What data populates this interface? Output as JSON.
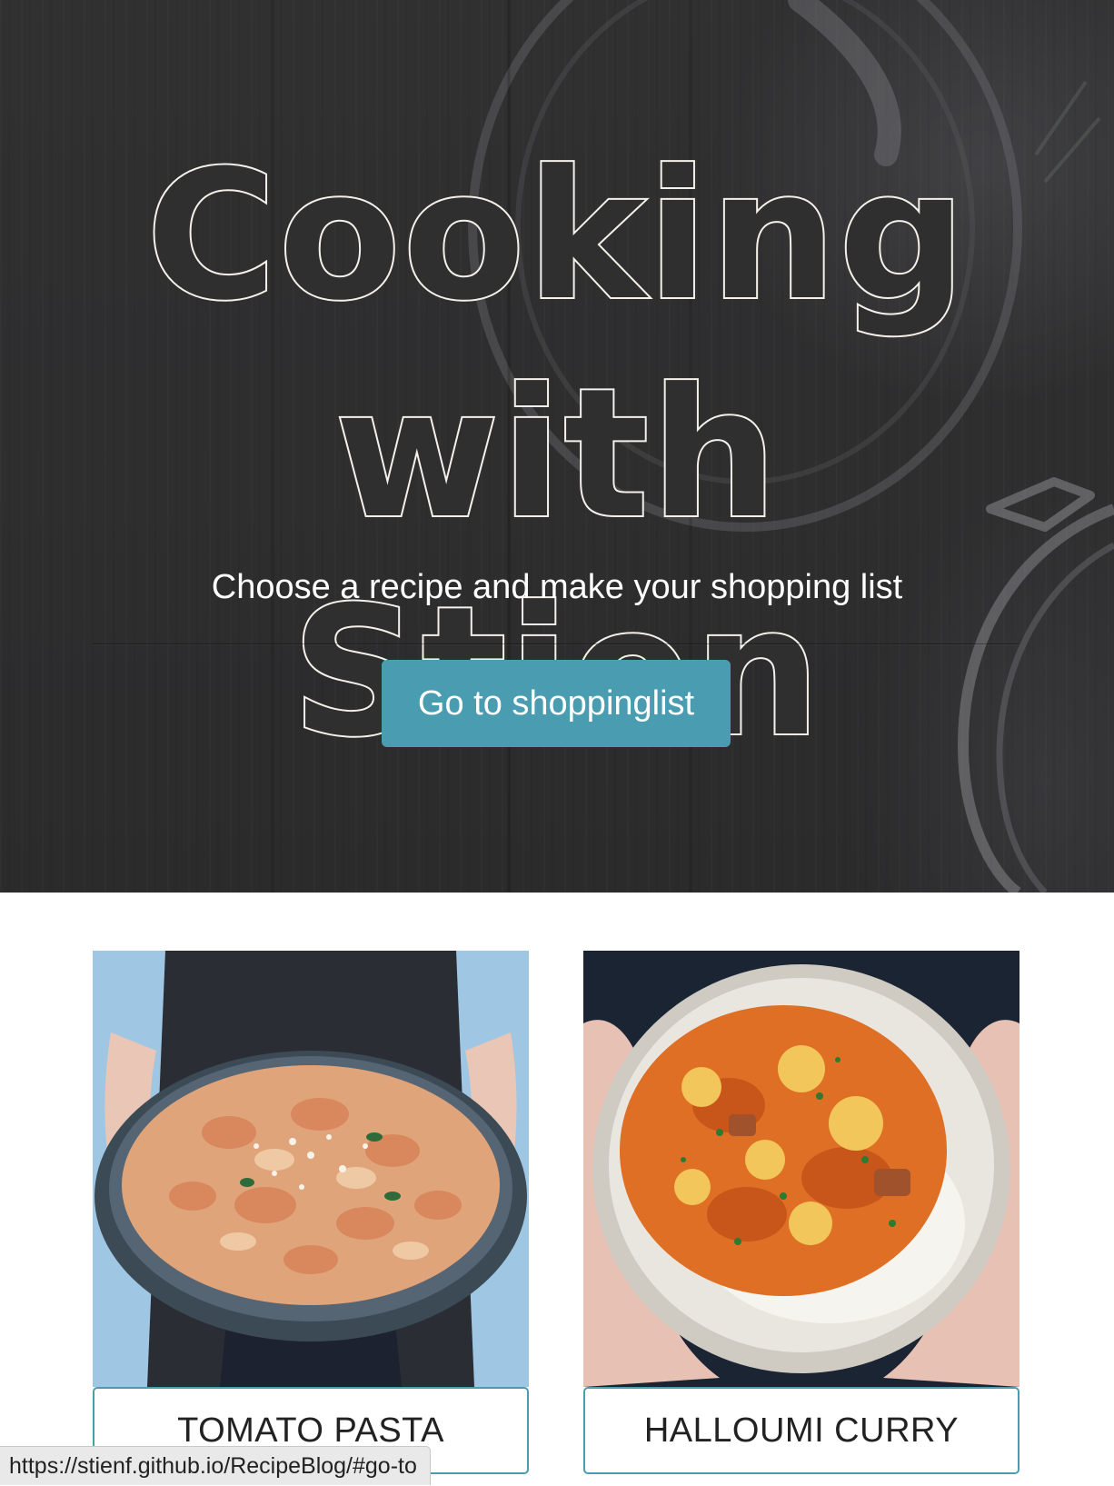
{
  "hero": {
    "title_line1": "Cooking with",
    "title_line2": "Stien",
    "subtitle": "Choose a recipe and make your shopping list",
    "button_label": "Go to shoppinglist"
  },
  "recipes": [
    {
      "label": "TOMATO PASTA",
      "image_icon": "tomato-pasta-photo"
    },
    {
      "label": "HALLOUMI CURRY",
      "image_icon": "halloumi-curry-photo"
    }
  ],
  "status_bar": {
    "url": "https://stienf.github.io/RecipeBlog/#go-to"
  },
  "colors": {
    "accent": "#4a9db1",
    "hero_background": "#2e2e2f",
    "hero_text": "#ffffff"
  }
}
